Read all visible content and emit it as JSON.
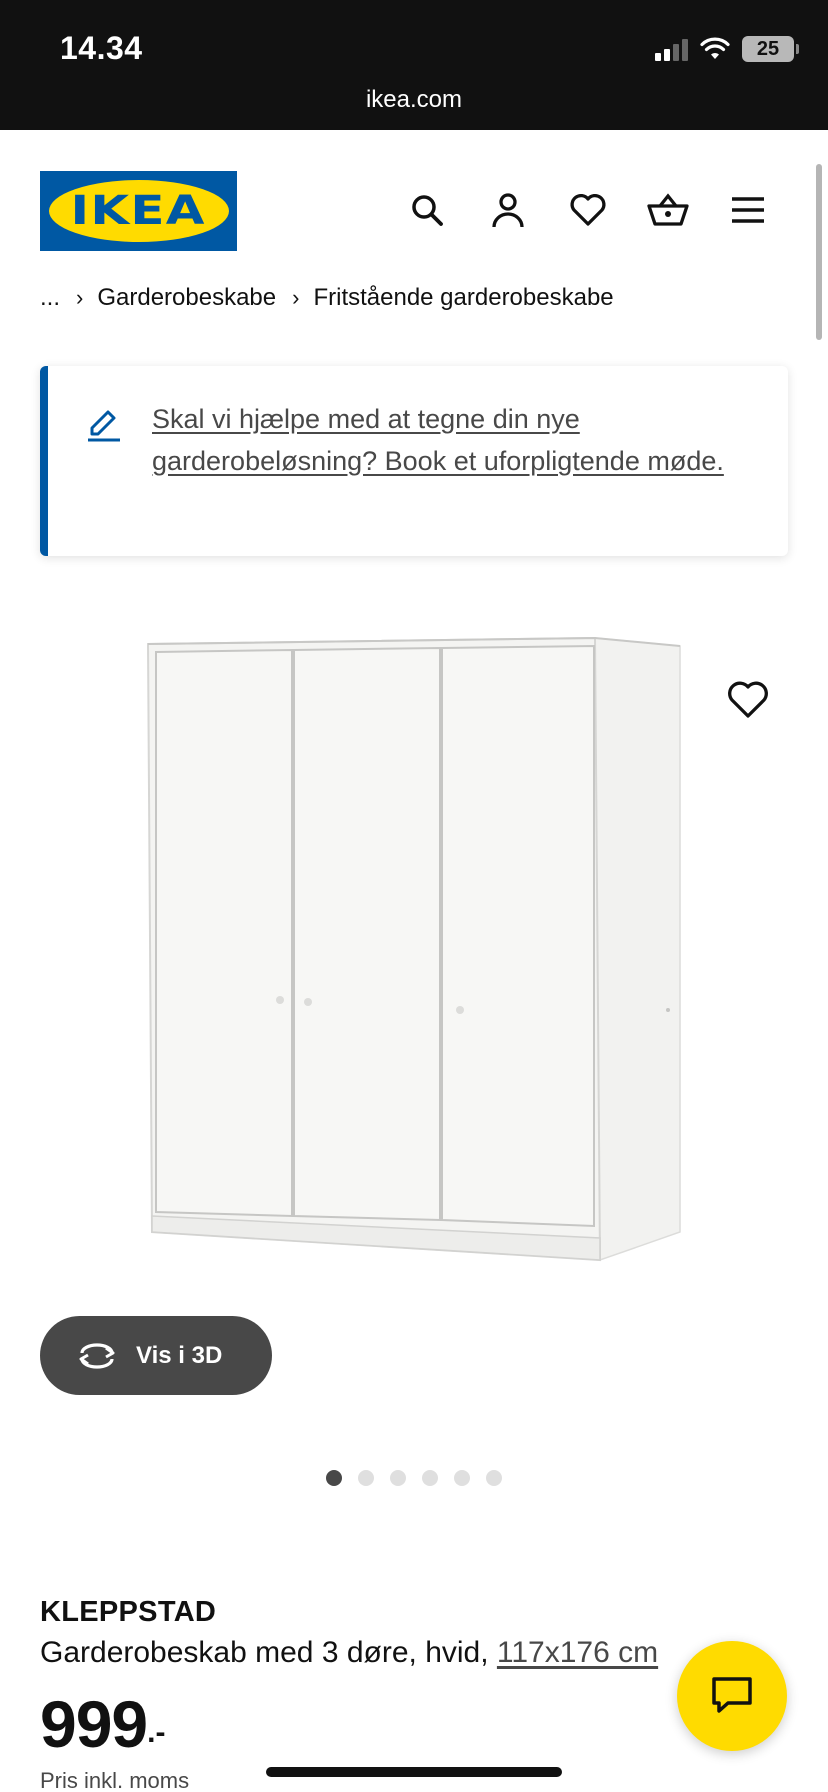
{
  "status_bar": {
    "time": "14.34",
    "battery": "25",
    "url": "ikea.com"
  },
  "header": {
    "logo_text": "IKEA",
    "brand_colors": {
      "blue": "#0058a3",
      "yellow": "#ffdb00"
    },
    "icons": [
      "search-icon",
      "profile-icon",
      "heart-icon",
      "basket-icon",
      "menu-icon"
    ]
  },
  "breadcrumb": {
    "ellipsis": "...",
    "separator": "›",
    "items": [
      "Garderobeskabe",
      "Fritstående garderobeskabe"
    ]
  },
  "banner": {
    "icon": "pencil-icon",
    "text": "Skal vi hjælpe med at tegne din nye garderobeløsning? Book et uforpligtende møde."
  },
  "gallery": {
    "vis3d_label": "Vis i 3D",
    "dot_count": 6,
    "active_dot": 0
  },
  "product": {
    "name": "KLEPPSTAD",
    "description": "Garderobeskab med 3 døre, hvid, ",
    "size": "117x176 cm",
    "price_int": "999",
    "price_dec": ".-",
    "vat_note": "Pris inkl. moms"
  }
}
